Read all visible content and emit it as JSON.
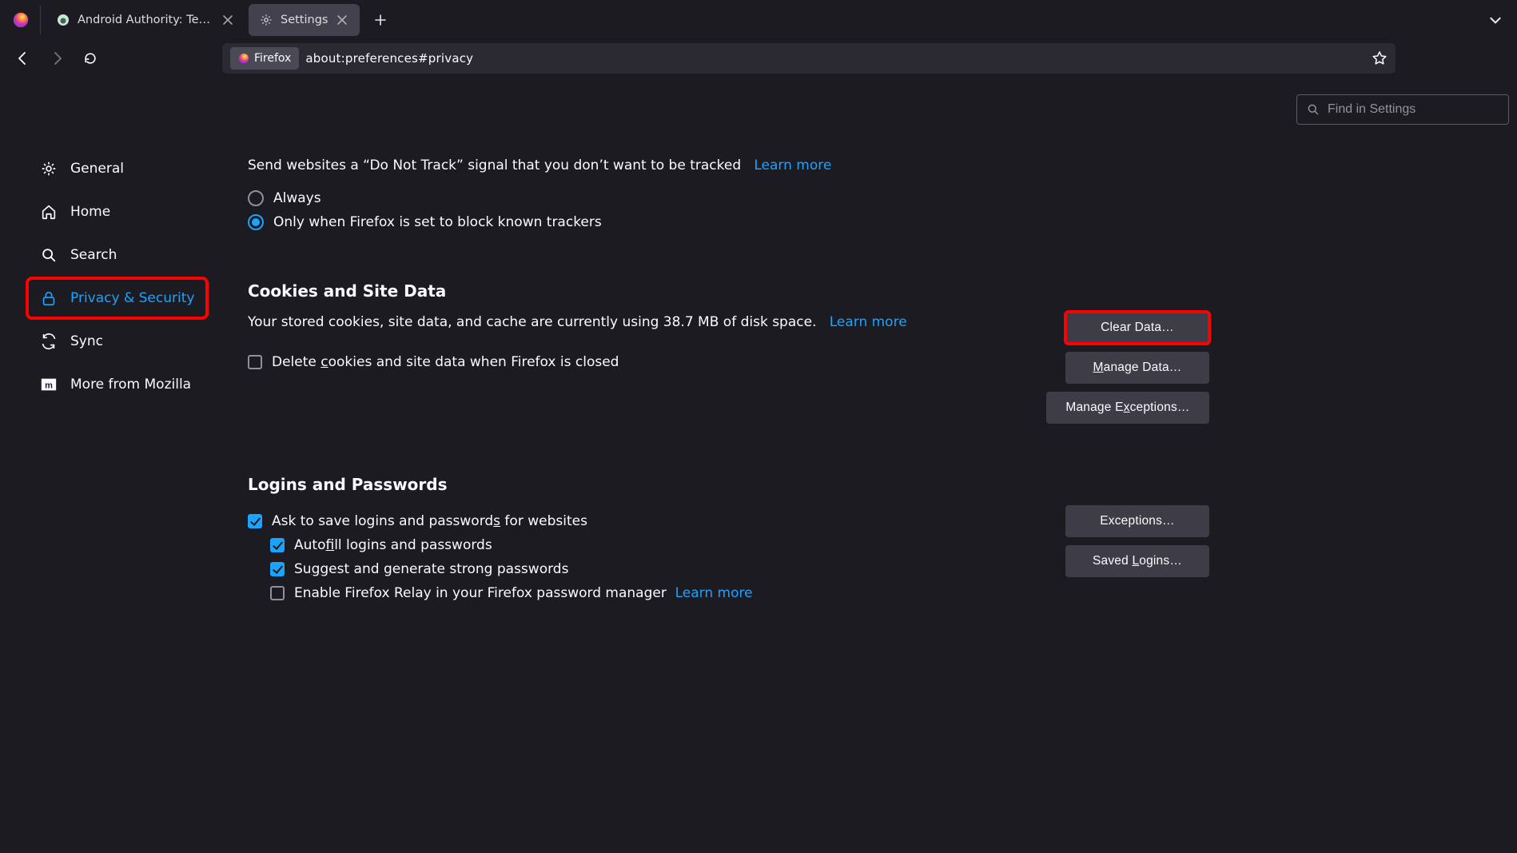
{
  "tabs": [
    {
      "label": "Android Authority: Tech Reviews"
    },
    {
      "label": "Settings"
    }
  ],
  "url": {
    "badge": "Firefox",
    "text": "about:preferences#privacy"
  },
  "search": {
    "placeholder": "Find in Settings"
  },
  "sidebar": [
    {
      "label": "General",
      "icon": "gear"
    },
    {
      "label": "Home",
      "icon": "home"
    },
    {
      "label": "Search",
      "icon": "search"
    },
    {
      "label": "Privacy & Security",
      "icon": "lock",
      "active": true
    },
    {
      "label": "Sync",
      "icon": "sync"
    },
    {
      "label": "More from Mozilla",
      "icon": "mozilla"
    }
  ],
  "dnt": {
    "intro": "Send websites a “Do Not Track” signal that you don’t want to be tracked",
    "learn_more": "Learn more",
    "always": "Always",
    "only_when": "Only when Firefox is set to block known trackers"
  },
  "cookies": {
    "title": "Cookies and Site Data",
    "desc_a": "Your stored cookies, site data, and cache are currently using 38.7 MB of disk space.",
    "learn_more": "Learn more",
    "delete_on_close_pre": "Delete ",
    "delete_on_close_u": "c",
    "delete_on_close_post": "ookies and site data when Firefox is closed",
    "btn_clear": "Clear Data…",
    "btn_manage_pre": "M",
    "btn_manage_post": "anage Data…",
    "btn_exceptions_pre": "Manage E",
    "btn_exceptions_u": "x",
    "btn_exceptions_post": "ceptions…"
  },
  "logins": {
    "title": "Logins and Passwords",
    "ask_pre": "Ask to save logins and password",
    "ask_u": "s",
    "ask_post": " for websites",
    "autofill_pre": "Auto",
    "autofill_u": "f",
    "autofill_post": "ill logins and passwords",
    "suggest_pre": "Su",
    "suggest_u": "g",
    "suggest_post": "gest and generate strong passwords",
    "relay": "Enable Firefox Relay in your Firefox password manager",
    "learn_more": "Learn more",
    "btn_exceptions": "Exceptions…",
    "btn_saved_pre": "Saved ",
    "btn_saved_u": "L",
    "btn_saved_post": "ogins…"
  }
}
